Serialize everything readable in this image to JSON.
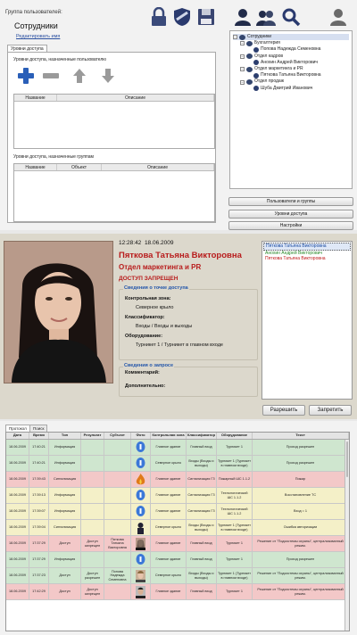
{
  "panel1": {
    "group_label": "Группа пользователей:",
    "group_name": "Сотрудники",
    "edit_link": "Редактировать имя",
    "tab_access": "Уровни доступа",
    "user_levels_title": "Уровни доступа, назначенные пользователю",
    "user_levels_columns": [
      "Название",
      "Описание"
    ],
    "group_levels_title": "Уровни доступа, назначенные группам",
    "group_levels_columns": [
      "Название",
      "Объект",
      "Описание"
    ],
    "buttons": [
      "Пользователи и группы",
      "Уровни доступа",
      "Настройки"
    ],
    "tree": [
      {
        "label": "Сотрудники",
        "level": 0,
        "type": "group",
        "selected": true
      },
      {
        "label": "Бухгалтерия",
        "level": 1,
        "type": "group"
      },
      {
        "label": "Попова Надежда Семеновна",
        "level": 2,
        "type": "person"
      },
      {
        "label": "Отдел кадров",
        "level": 1,
        "type": "group"
      },
      {
        "label": "Анохин Андрей Викторович",
        "level": 2,
        "type": "person"
      },
      {
        "label": "Отдел маркетинга и PR",
        "level": 1,
        "type": "group"
      },
      {
        "label": "Пяткова Татьяна Викторовна",
        "level": 2,
        "type": "person"
      },
      {
        "label": "Отдел продаж",
        "level": 1,
        "type": "group"
      },
      {
        "label": "Шуба Дмитрий Иванович",
        "level": 2,
        "type": "person"
      }
    ]
  },
  "panel2": {
    "time": "12:28:42",
    "date": "18.06.2009",
    "person": "Пяткова Татьяна Викторовна",
    "department": "Отдел маркетинга и PR",
    "status": "доступ запрещен",
    "access_point_header": "Сведения о точке доступа",
    "control_zone_label": "Контрольная зона:",
    "control_zone_value": "Северное крыло",
    "classifier_label": "Классификатор:",
    "classifier_value": "Входы / Входы и выходы",
    "equipment_label": "Оборудование:",
    "equipment_value": "Турникет 1 / Турникет в главном входе",
    "request_header": "Сведения о запросе",
    "comment_label": "Комментарий:",
    "additional_label": "Дополнительно:",
    "queue": [
      {
        "name": "Пяткова Татьяна Викторовна",
        "color": "#1a4aa0",
        "selected": true
      },
      {
        "name": "Анохин Андрей Викторович",
        "color": "#2a8a2a"
      },
      {
        "name": "Пяткова Татьяна Викторовна",
        "color": "#c01a1a"
      }
    ],
    "allow_button": "Разрешить",
    "deny_button": "Запретить"
  },
  "panel3": {
    "tabs": [
      "Протокол",
      "Поиск"
    ],
    "columns": [
      "Дата",
      "Время",
      "Тип",
      "Результат",
      "Субъект",
      "Фото",
      "Контрольная зона",
      "Классификатор",
      "Оборудование",
      "Текст"
    ],
    "rows": [
      {
        "bg": "#cfe6cf",
        "cells": [
          "18.06.2009",
          "17:40:21",
          "Информация",
          "",
          "",
          "",
          "Главное здание",
          "Главный вход",
          "Турникет 1",
          "Проход разрешен"
        ],
        "icon": "info"
      },
      {
        "bg": "#cfe6cf",
        "cells": [
          "18.06.2009",
          "17:40:21",
          "Информация",
          "",
          "",
          "",
          "Северное крыло",
          "Входы (Входы и выходы)",
          "Турникет 1 (Турникет в главном входе)",
          "Проход разрешен"
        ],
        "icon": "info"
      },
      {
        "bg": "#f3c8c8",
        "cells": [
          "18.06.2009",
          "17:39:43",
          "Сигнализация",
          "",
          "",
          "",
          "Главное здание",
          "Сигнализация ГЗ",
          "Пожарный ШС 1.1.2",
          "Пожар"
        ],
        "icon": "fire"
      },
      {
        "bg": "#f4f0c8",
        "cells": [
          "18.06.2009",
          "17:39:13",
          "Информация",
          "",
          "",
          "",
          "Главное здание",
          "Сигнализация ГЗ",
          "Технологический ШС 1.1.2",
          "Восстановление ТС"
        ],
        "icon": "info"
      },
      {
        "bg": "#f4f0c8",
        "cells": [
          "18.06.2009",
          "17:39:07",
          "Информация",
          "",
          "",
          "",
          "Главное здание",
          "Сигнализация ГЗ",
          "Технологический ШС 1.1.2",
          "Вход = 1"
        ],
        "icon": "info"
      },
      {
        "bg": "#f4f0c8",
        "cells": [
          "18.06.2009",
          "17:39:04",
          "Сигнализация",
          "",
          "",
          "",
          "Северное крыло",
          "Входы (Входы и выходы)",
          "Турникет 1 (Турникет в главном входе)",
          "Ошибка авторизации"
        ],
        "icon": "guard"
      },
      {
        "bg": "#f3c8c8",
        "cells": [
          "18.06.2009",
          "17:37:29",
          "Доступ",
          "Доступ запрещен",
          "Пяткова Татьяна Викторовна",
          "",
          "Главное здание",
          "Главный вход",
          "Турникет 1",
          "Решение от \"Подсистемы охраны\", централизованный режим."
        ],
        "icon": "woman"
      },
      {
        "bg": "#cfe6cf",
        "cells": [
          "18.06.2009",
          "17:37:29",
          "Информация",
          "",
          "",
          "",
          "Главное здание",
          "Главный вход",
          "Турникет 1",
          "Проход разрешен"
        ],
        "icon": "info"
      },
      {
        "bg": "#cfe6cf",
        "cells": [
          "18.06.2009",
          "17:37:23",
          "Доступ",
          "Доступ разрешен",
          "Попова Надежда Семеновна",
          "",
          "Северное крыло",
          "Входы (Входы и выходы)",
          "Турникет 1 (Турникет в главном входе)",
          "Решение от \"Подсистемы охраны\", централизованный режим."
        ],
        "icon": "woman2"
      },
      {
        "bg": "#f3c8c8",
        "cells": [
          "18.06.2009",
          "17:42:29",
          "Доступ",
          "Доступ запрещен",
          "",
          "",
          "Главное здание",
          "Главный вход",
          "Турникет 1",
          "Решение от \"Подсистемы охраны\", централизованный режим."
        ],
        "icon": "man"
      }
    ]
  }
}
